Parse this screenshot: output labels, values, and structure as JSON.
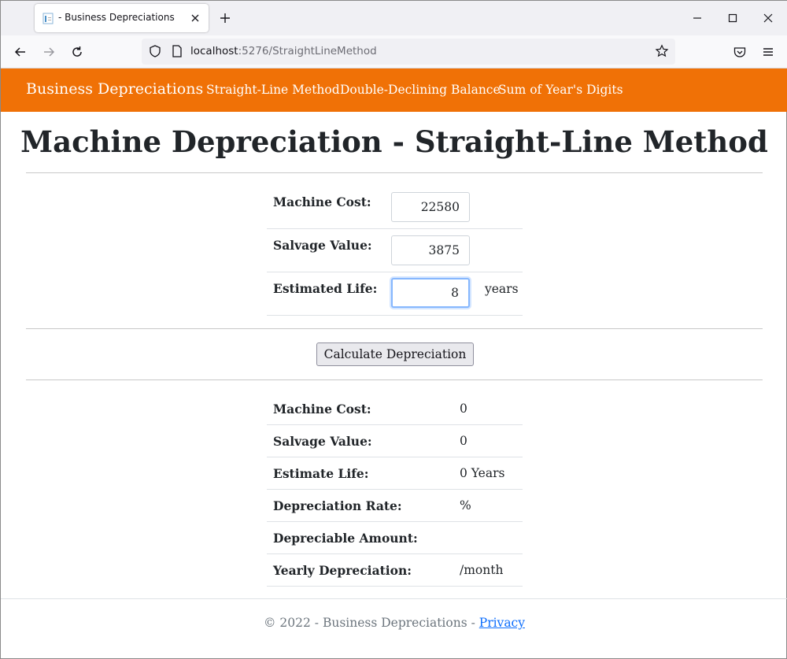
{
  "browser": {
    "tab_title": "- Business Depreciations",
    "url_host": "localhost",
    "url_rest": ":5276/StraightLineMethod",
    "icons": [
      "favicon-icon",
      "close-icon",
      "plus-icon",
      "minimize-icon",
      "maximize-icon",
      "close-window-icon",
      "back-arrow-icon",
      "forward-arrow-icon",
      "reload-icon",
      "shield-icon",
      "page-icon",
      "star-icon",
      "pocket-icon",
      "menu-icon"
    ]
  },
  "nav": {
    "brand": "Business Depreciations",
    "links": [
      "Straight-Line Method",
      "Double-Declining Balance",
      "Sum of Year's Digits"
    ],
    "background_color": "#f07106"
  },
  "page": {
    "title": "Machine Depreciation - Straight-Line Method"
  },
  "form": {
    "machine_cost_label": "Machine Cost:",
    "machine_cost_value": "22580",
    "salvage_value_label": "Salvage Value:",
    "salvage_value_value": "3875",
    "estimated_life_label": "Estimated Life:",
    "estimated_life_value": "8",
    "estimated_life_unit": "years",
    "calculate_label": "Calculate Depreciation"
  },
  "results": [
    {
      "label": "Machine Cost:",
      "value": "0"
    },
    {
      "label": "Salvage Value:",
      "value": "0"
    },
    {
      "label": "Estimate Life:",
      "value": "0 Years"
    },
    {
      "label": "Depreciation Rate:",
      "value": "%"
    },
    {
      "label": "Depreciable Amount:",
      "value": ""
    },
    {
      "label": "Yearly Depreciation:",
      "value": "/month"
    }
  ],
  "footer": {
    "text": "© 2022 - Business Depreciations - ",
    "privacy_link": "Privacy"
  }
}
